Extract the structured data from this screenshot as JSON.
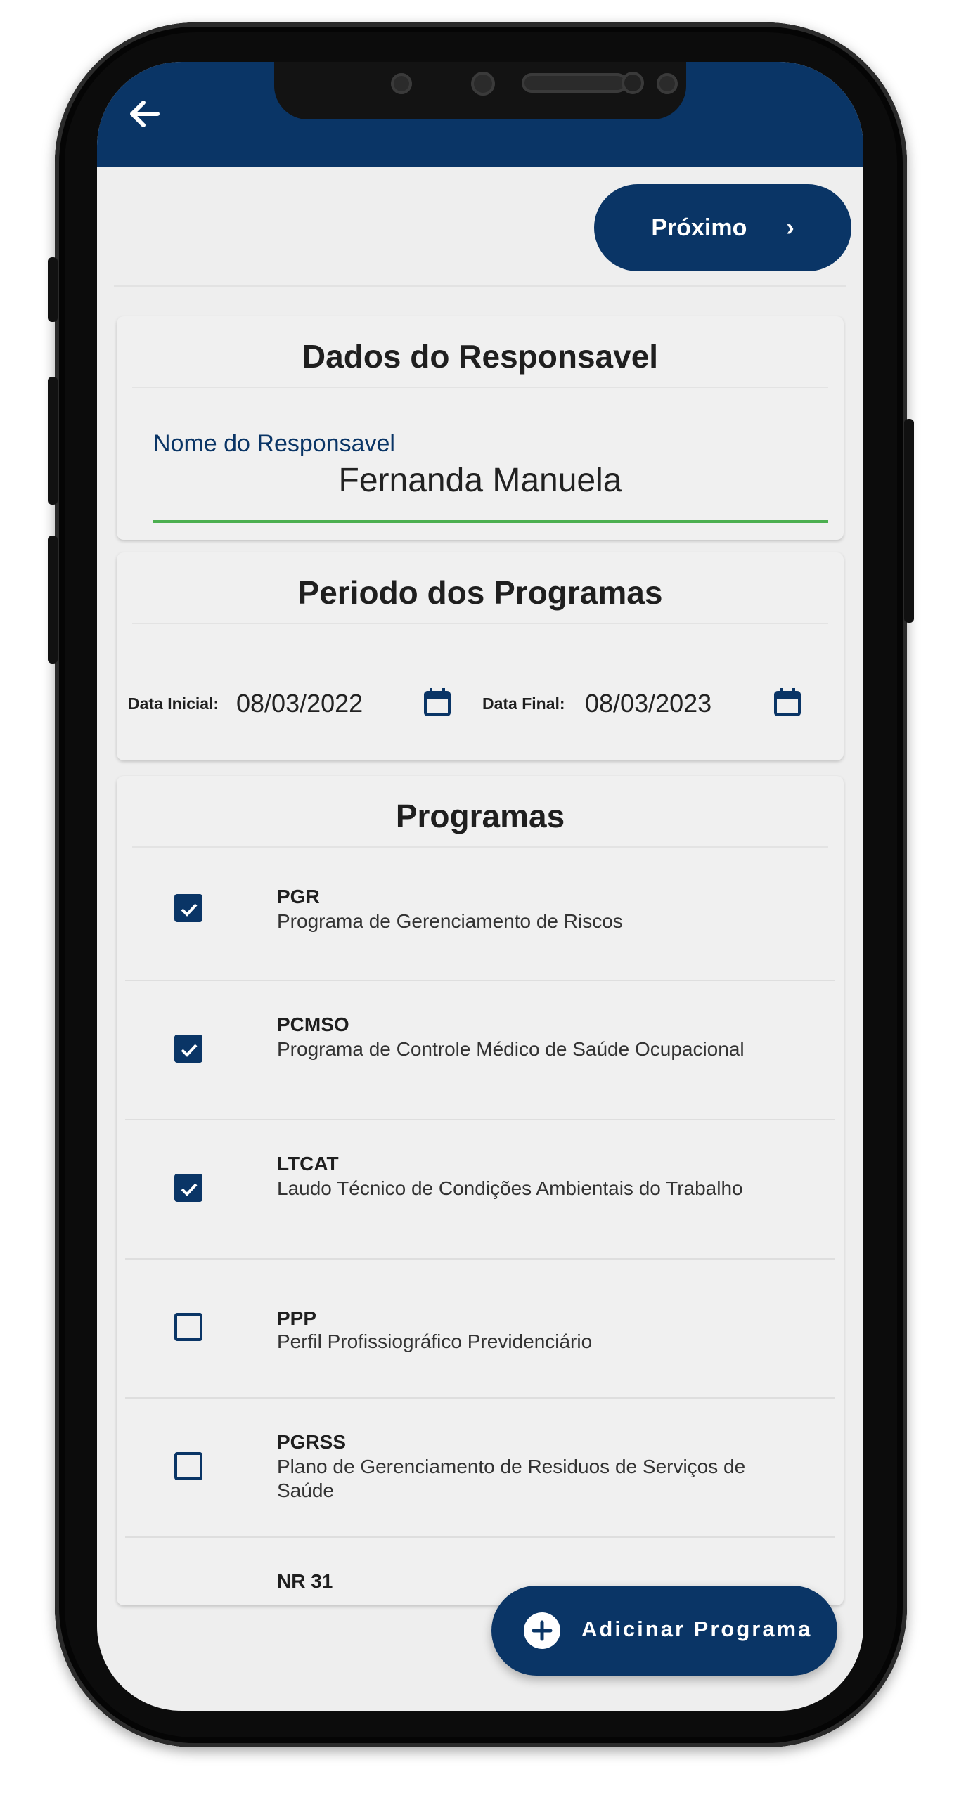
{
  "header": {
    "back_label": "back"
  },
  "toolbar": {
    "next_label": "Próximo",
    "next_chevron": "›"
  },
  "responsavel": {
    "title": "Dados do Responsavel",
    "field_label": "Nome do Responsavel",
    "field_value": "Fernanda Manuela"
  },
  "periodo": {
    "title": "Periodo dos Programas",
    "start_label": "Data Inicial:",
    "start_value": "08/03/2022",
    "end_label": "Data Final:",
    "end_value": "08/03/2023"
  },
  "programas": {
    "title": "Programas",
    "items": [
      {
        "code": "PGR",
        "name": "Programa de Gerenciamento de Riscos",
        "checked": true
      },
      {
        "code": "PCMSO",
        "name": "Programa de Controle Médico de Saúde Ocupacional",
        "checked": true
      },
      {
        "code": "LTCAT",
        "name": "Laudo Técnico de Condições Ambientais do Trabalho",
        "checked": true
      },
      {
        "code": "PPP",
        "name": "Perfil Profissiográfico Previdenciário",
        "checked": false
      },
      {
        "code": "PGRSS",
        "name": "Plano de Gerenciamento de Residuos de Serviços de Saúde",
        "checked": false
      },
      {
        "code": "NR 31",
        "name": "",
        "checked": false
      }
    ]
  },
  "fab": {
    "label": "Adicinar Programa"
  },
  "colors": {
    "primary": "#0a3566",
    "background": "#eeeeee",
    "accent_underline": "#4caf50"
  }
}
